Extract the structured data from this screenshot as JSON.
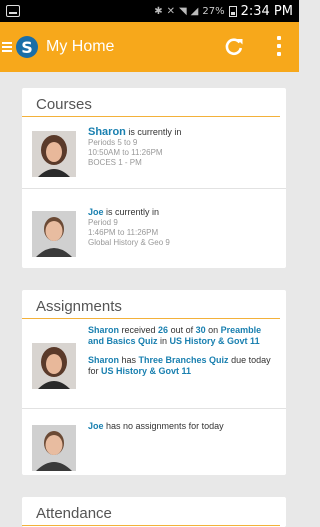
{
  "status_bar": {
    "battery": "27%",
    "time": "2:34 PM"
  },
  "app_bar": {
    "title": "My Home",
    "logo_letter": "S"
  },
  "courses": {
    "title": "Courses",
    "items": [
      {
        "name": "Sharon",
        "status": " is currently in",
        "periods": "Periods 5 to 9",
        "time": "10:50AM to 11:26PM",
        "course": "BOCES 1 - PM"
      },
      {
        "name": "Joe",
        "status": " is currently in",
        "periods": "Period 9",
        "time": "1:46PM to 11:26PM",
        "course": "Global History & Geo 9"
      }
    ]
  },
  "assignments": {
    "title": "Assignments",
    "sharon": {
      "name": "Sharon",
      "received": " received ",
      "score": "26",
      "out_of": " out of ",
      "total": "30",
      "on": " on ",
      "quiz1": "Preamble and Basics Quiz",
      "in1": " in ",
      "course1": "US History & Govt 11",
      "name2": "Sharon",
      "has": " has ",
      "quiz2": "Three Branches Quiz",
      "due": " due today for ",
      "course2": "US History & Govt 11"
    },
    "joe": {
      "name": "Joe",
      "text": " has no assignments for today"
    }
  },
  "attendance": {
    "title": "Attendance"
  },
  "colors": {
    "app_bar": "#f7a81b",
    "link": "#1a80b0",
    "logo": "#1a6ea8"
  }
}
